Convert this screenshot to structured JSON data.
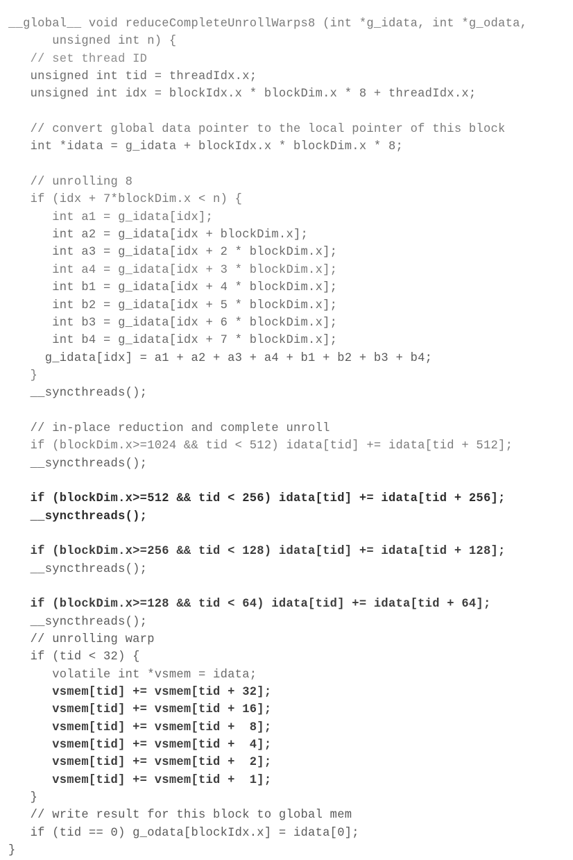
{
  "document": {
    "kind": "source-code-listing",
    "language": "CUDA C",
    "function_name": "reduceCompleteUnrollWarps8",
    "background_color": "#ffffff",
    "text_color": "#6a6a6a"
  },
  "code": {
    "lines": [
      {
        "text": "__global__ void reduceCompleteUnrollWarps8 (int *g_idata, int *g_odata,",
        "ink": "ink-light"
      },
      {
        "text": "      unsigned int n) {",
        "ink": "ink-light"
      },
      {
        "text": "   // set thread ID",
        "ink": "ink-faint"
      },
      {
        "text": "   unsigned int tid = threadIdx.x;",
        "ink": "ink-normal"
      },
      {
        "text": "   unsigned int idx = blockIdx.x * blockDim.x * 8 + threadIdx.x;",
        "ink": "ink-normal"
      },
      {
        "text": "",
        "ink": "blank"
      },
      {
        "text": "   // convert global data pointer to the local pointer of this block",
        "ink": "ink-light"
      },
      {
        "text": "   int *idata = g_idata + blockIdx.x * blockDim.x * 8;",
        "ink": "ink-normal"
      },
      {
        "text": "",
        "ink": "blank"
      },
      {
        "text": "   // unrolling 8",
        "ink": "ink-light"
      },
      {
        "text": "   if (idx + 7*blockDim.x < n) {",
        "ink": "ink-light"
      },
      {
        "text": "      int a1 = g_idata[idx];",
        "ink": "ink-light"
      },
      {
        "text": "      int a2 = g_idata[idx + blockDim.x];",
        "ink": "ink-normal"
      },
      {
        "text": "      int a3 = g_idata[idx + 2 * blockDim.x];",
        "ink": "ink-normal"
      },
      {
        "text": "      int a4 = g_idata[idx + 3 * blockDim.x];",
        "ink": "ink-light"
      },
      {
        "text": "      int b1 = g_idata[idx + 4 * blockDim.x];",
        "ink": "ink-normal"
      },
      {
        "text": "      int b2 = g_idata[idx + 5 * blockDim.x];",
        "ink": "ink-normal"
      },
      {
        "text": "      int b3 = g_idata[idx + 6 * blockDim.x];",
        "ink": "ink-normal"
      },
      {
        "text": "      int b4 = g_idata[idx + 7 * blockDim.x];",
        "ink": "ink-normal"
      },
      {
        "text": "     g_idata[idx] = a1 + a2 + a3 + a4 + b1 + b2 + b3 + b4;",
        "ink": "ink-mid"
      },
      {
        "text": "   }",
        "ink": "ink-light"
      },
      {
        "text": "   __syncthreads();",
        "ink": "ink-mid"
      },
      {
        "text": "",
        "ink": "blank"
      },
      {
        "text": "   // in-place reduction and complete unroll",
        "ink": "ink-normal"
      },
      {
        "text": "   if (blockDim.x>=1024 && tid < 512) idata[tid] += idata[tid + 512];",
        "ink": "ink-light"
      },
      {
        "text": "   __syncthreads();",
        "ink": "ink-mid"
      },
      {
        "text": "",
        "ink": "blank"
      },
      {
        "text": "   if (blockDim.x>=512 && tid < 256) idata[tid] += idata[tid + 256];",
        "ink": "ink-black"
      },
      {
        "text": "   __syncthreads();",
        "ink": "ink-black"
      },
      {
        "text": "",
        "ink": "blank"
      },
      {
        "text": "   if (blockDim.x>=256 && tid < 128) idata[tid] += idata[tid + 128];",
        "ink": "ink-dark"
      },
      {
        "text": "   __syncthreads();",
        "ink": "ink-mid"
      },
      {
        "text": "",
        "ink": "blank"
      },
      {
        "text": "   if (blockDim.x>=128 && tid < 64) idata[tid] += idata[tid + 64];",
        "ink": "ink-dark"
      },
      {
        "text": "   __syncthreads();",
        "ink": "ink-mid"
      },
      {
        "text": "   // unrolling warp",
        "ink": "ink-mid"
      },
      {
        "text": "   if (tid < 32) {",
        "ink": "ink-mid"
      },
      {
        "text": "      volatile int *vsmem = idata;",
        "ink": "ink-normal"
      },
      {
        "text": "      vsmem[tid] += vsmem[tid + 32];",
        "ink": "ink-dark"
      },
      {
        "text": "      vsmem[tid] += vsmem[tid + 16];",
        "ink": "ink-dark"
      },
      {
        "text": "      vsmem[tid] += vsmem[tid +  8];",
        "ink": "ink-dark"
      },
      {
        "text": "      vsmem[tid] += vsmem[tid +  4];",
        "ink": "ink-dark"
      },
      {
        "text": "      vsmem[tid] += vsmem[tid +  2];",
        "ink": "ink-dark"
      },
      {
        "text": "      vsmem[tid] += vsmem[tid +  1];",
        "ink": "ink-dark"
      },
      {
        "text": "   }",
        "ink": "ink-mid"
      },
      {
        "text": "   // write result for this block to global mem",
        "ink": "ink-mid"
      },
      {
        "text": "   if (tid == 0) g_odata[blockIdx.x] = idata[0];",
        "ink": "ink-mid"
      },
      {
        "text": "}",
        "ink": "ink-mid"
      }
    ]
  }
}
